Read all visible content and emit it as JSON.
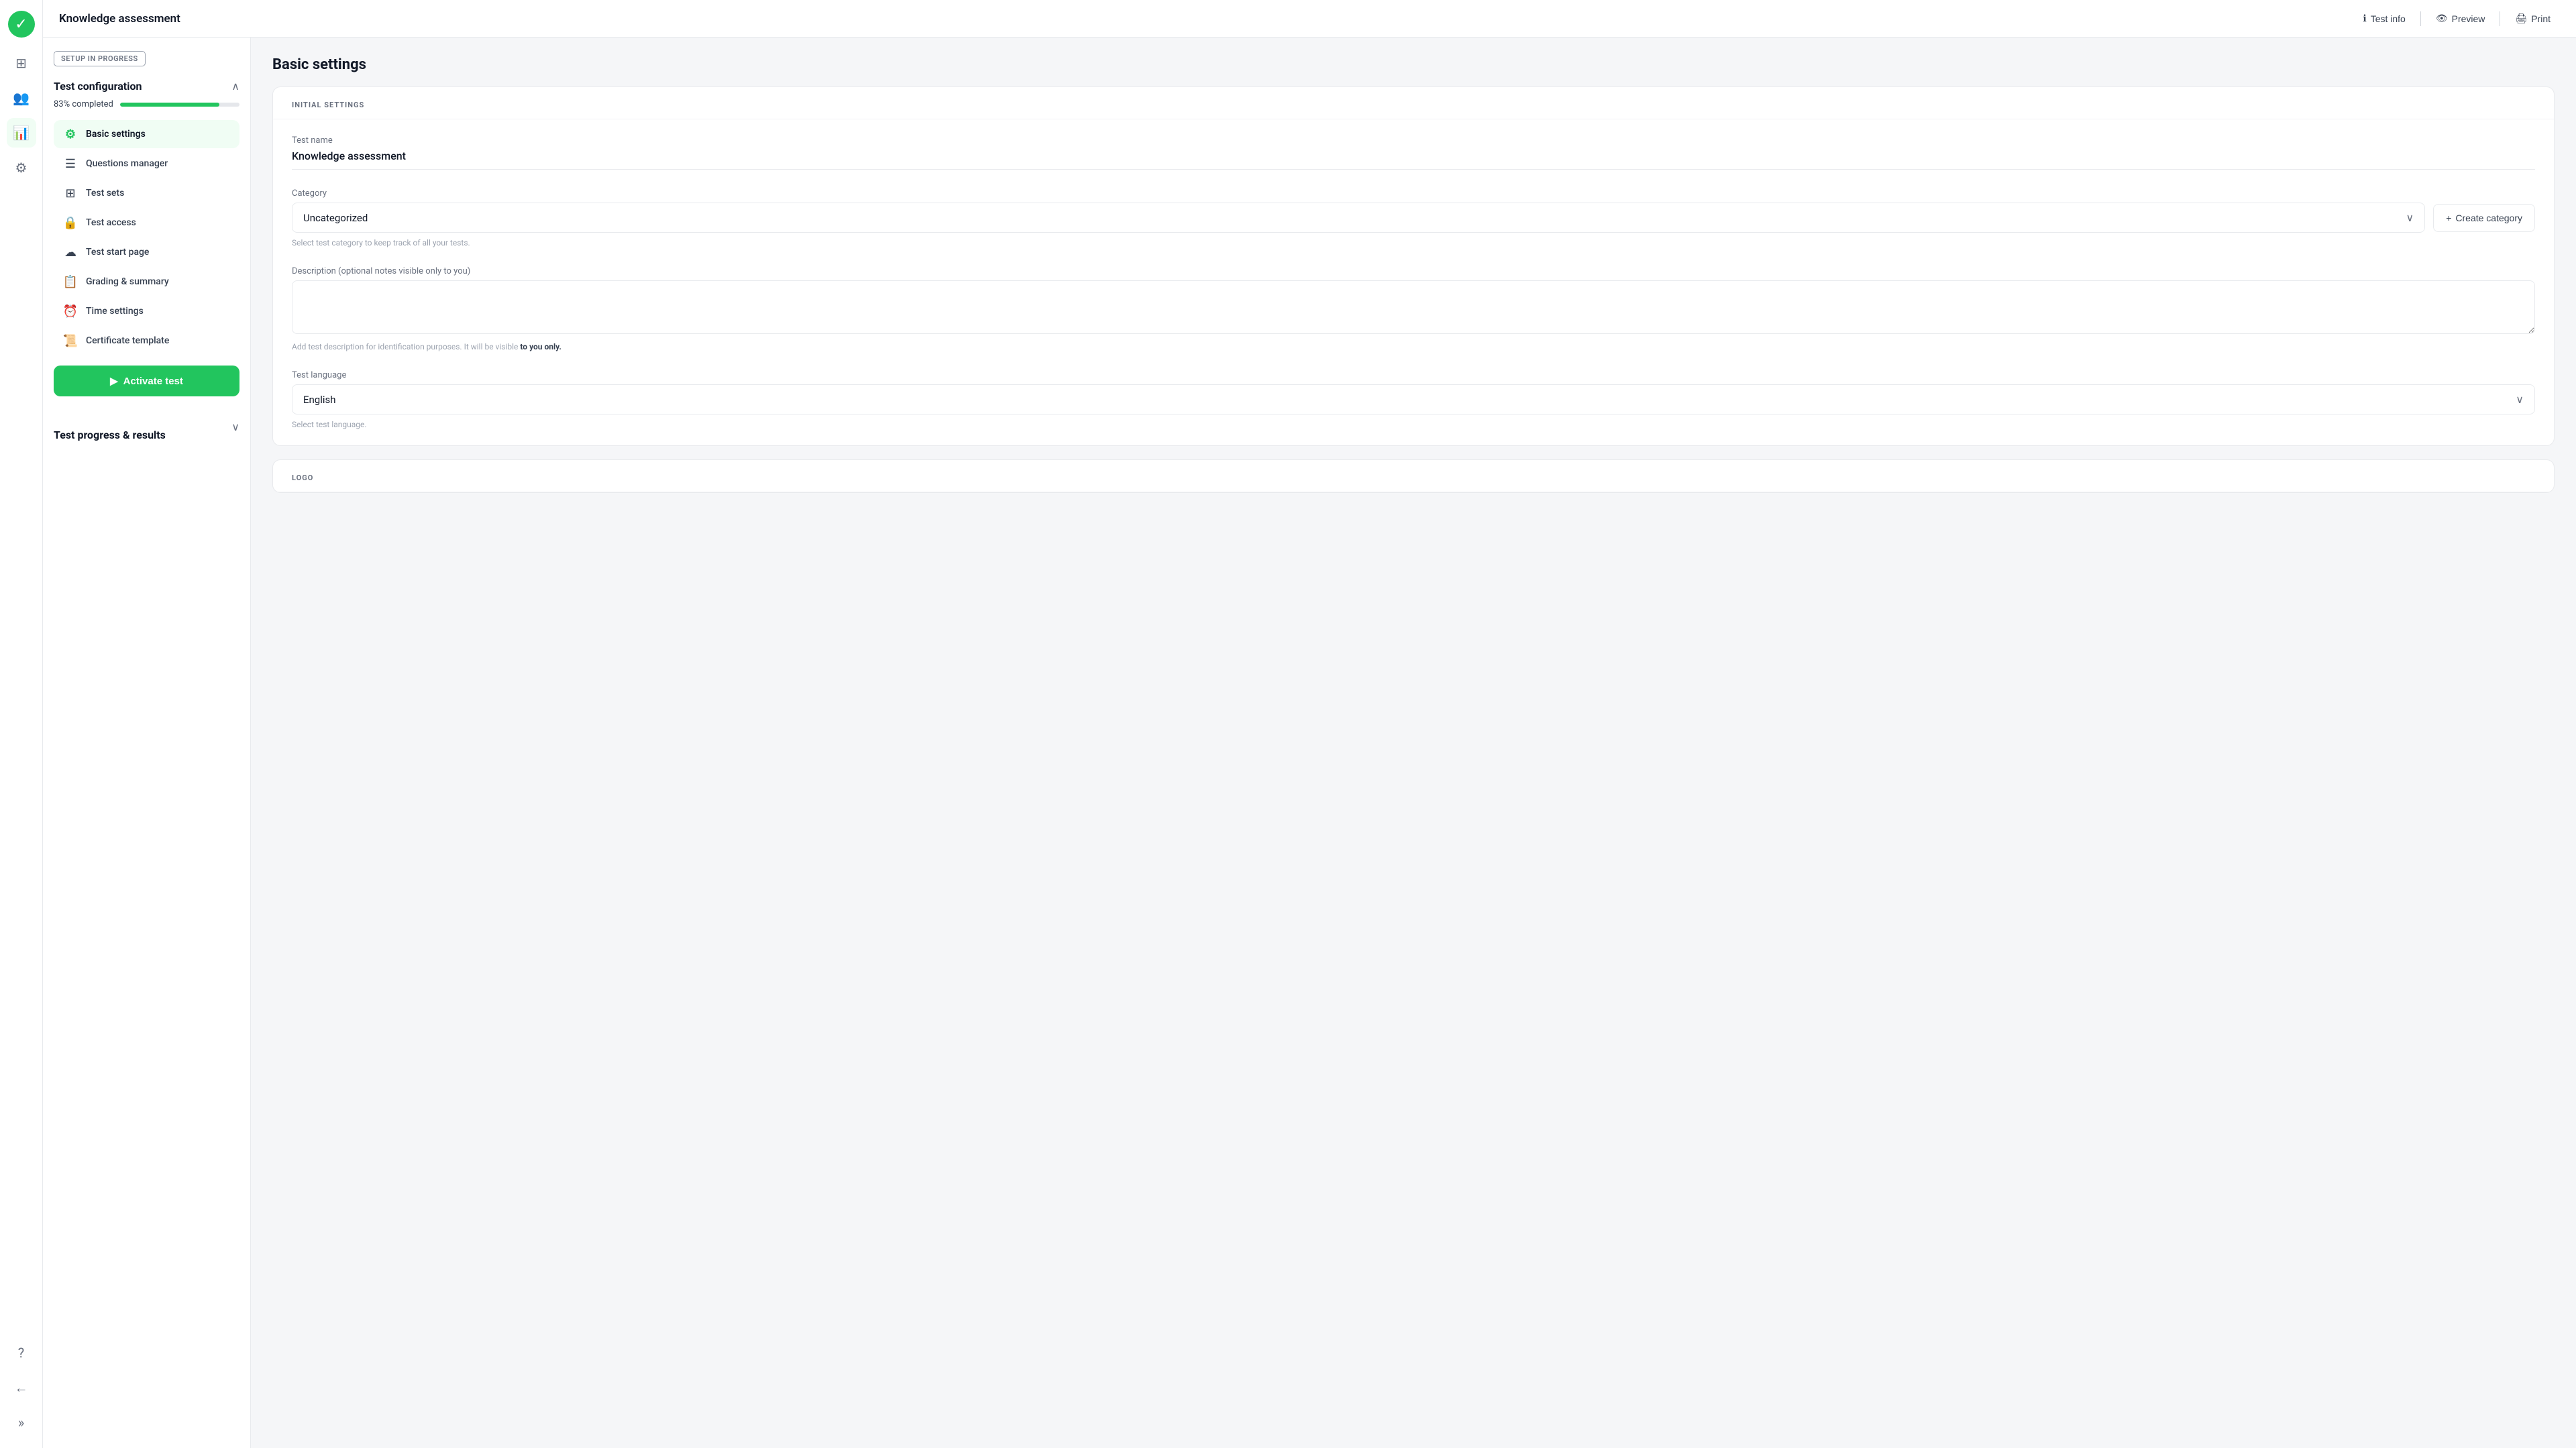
{
  "app": {
    "logo_icon": "✓",
    "title": "Knowledge assessment"
  },
  "icon_nav": {
    "items": [
      {
        "icon": "⊞",
        "name": "grid-icon",
        "active": false
      },
      {
        "icon": "👥",
        "name": "users-icon",
        "active": false
      },
      {
        "icon": "📊",
        "name": "analytics-icon",
        "active": true
      },
      {
        "icon": "⚙",
        "name": "settings-icon",
        "active": false
      }
    ],
    "bottom_items": [
      {
        "icon": "?",
        "name": "help-icon"
      },
      {
        "icon": "←",
        "name": "back-icon"
      },
      {
        "icon": "»",
        "name": "expand-icon"
      }
    ]
  },
  "header": {
    "title": "Knowledge assessment",
    "actions": [
      {
        "label": "Test info",
        "icon": "ℹ",
        "name": "test-info-btn"
      },
      {
        "label": "Preview",
        "icon": "👁",
        "name": "preview-btn"
      },
      {
        "label": "Print",
        "icon": "🖨",
        "name": "print-btn"
      }
    ]
  },
  "sidebar": {
    "setup_badge": "SETUP IN PROGRESS",
    "config_section": {
      "title": "Test configuration",
      "progress_label": "83% completed",
      "progress_value": 83,
      "nav_items": [
        {
          "label": "Basic settings",
          "icon": "⚙",
          "name": "basic-settings-nav",
          "active": true
        },
        {
          "label": "Questions manager",
          "icon": "≡",
          "name": "questions-manager-nav",
          "active": false
        },
        {
          "label": "Test sets",
          "icon": "⊞",
          "name": "test-sets-nav",
          "active": false
        },
        {
          "label": "Test access",
          "icon": "🔒",
          "name": "test-access-nav",
          "active": false
        },
        {
          "label": "Test start page",
          "icon": "☁",
          "name": "test-start-page-nav",
          "active": false
        },
        {
          "label": "Grading & summary",
          "icon": "📋",
          "name": "grading-summary-nav",
          "active": false
        },
        {
          "label": "Time settings",
          "icon": "⏰",
          "name": "time-settings-nav",
          "active": false
        },
        {
          "label": "Certificate template",
          "icon": "📜",
          "name": "certificate-template-nav",
          "active": false
        }
      ],
      "activate_btn": "Activate test"
    },
    "results_section": {
      "title": "Test progress & results"
    }
  },
  "main": {
    "page_title": "Basic settings",
    "initial_settings_label": "INITIAL SETTINGS",
    "test_name": {
      "label": "Test name",
      "value": "Knowledge assessment"
    },
    "category": {
      "label": "Category",
      "value": "Uncategorized",
      "hint": "Select test category to keep track of all your tests.",
      "create_btn": "+ Create category"
    },
    "description": {
      "label": "Description (optional notes visible only to you)",
      "value": "",
      "hint_prefix": "Add test description for identification purposes. It will be visible ",
      "hint_bold": "to you only.",
      "placeholder": ""
    },
    "language": {
      "label": "Test language",
      "value": "English",
      "hint": "Select test language."
    },
    "logo_section_label": "LOGO"
  }
}
